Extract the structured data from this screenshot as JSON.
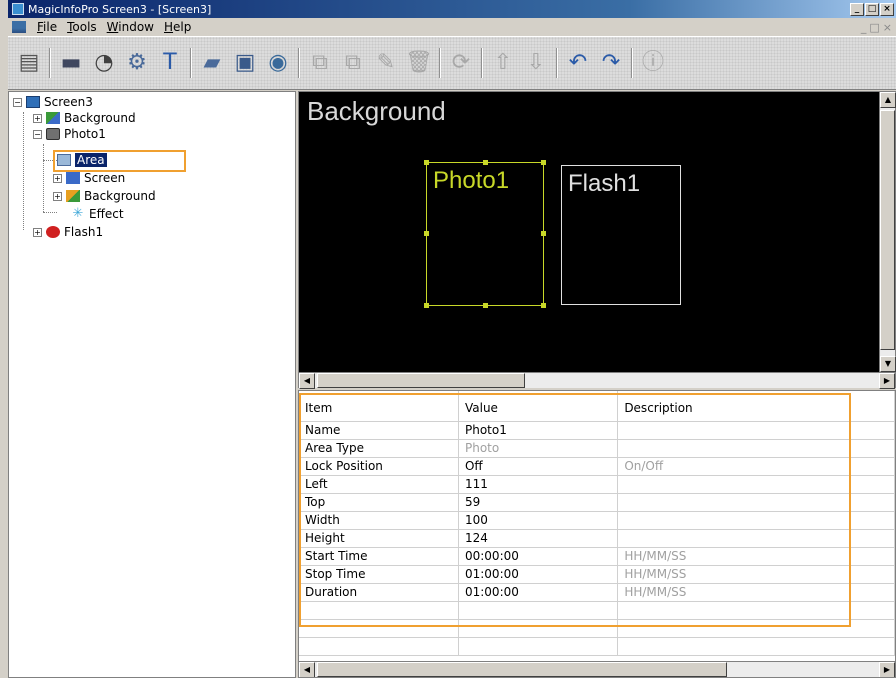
{
  "window": {
    "title": "MagicInfoPro Screen3 - [Screen3]",
    "buttons": [
      "_",
      "□",
      "×"
    ]
  },
  "menu": {
    "items": [
      "File",
      "Tools",
      "Window",
      "Help"
    ],
    "mdi_buttons": [
      "_",
      "□",
      "×"
    ]
  },
  "toolbar": {
    "buttons": [
      {
        "icon": "monitor-down-icon",
        "glyph": "▤",
        "color": "#555555"
      },
      {
        "icon": "display-icon",
        "glyph": "▬",
        "color": "#404860"
      },
      {
        "icon": "timer-icon",
        "glyph": "◔",
        "color": "#404040"
      },
      {
        "icon": "settings-icon",
        "glyph": "⚙",
        "color": "#4a6a9a"
      },
      {
        "icon": "text-icon",
        "glyph": "T",
        "color": "#2a5aa8"
      },
      {
        "icon": "open-folder-icon",
        "glyph": "▰",
        "color": "#4a6a9a"
      },
      {
        "icon": "save-icon",
        "glyph": "▣",
        "color": "#3a5a8a"
      },
      {
        "icon": "preview-icon",
        "glyph": "◉",
        "color": "#3a6a9a"
      },
      {
        "icon": "add-area-icon",
        "glyph": "⧉",
        "color": "#a8a8a8"
      },
      {
        "icon": "duplicate-area-icon",
        "glyph": "⧉",
        "color": "#a8a8a8"
      },
      {
        "icon": "paste-area-icon",
        "glyph": "✎",
        "color": "#a8a8a8"
      },
      {
        "icon": "delete-icon",
        "glyph": "🗑",
        "color": "#a8a8a8"
      },
      {
        "icon": "refresh-icon",
        "glyph": "⟳",
        "color": "#a8a8a8"
      },
      {
        "icon": "bring-front-icon",
        "glyph": "⇧",
        "color": "#a8a8a8"
      },
      {
        "icon": "send-back-icon",
        "glyph": "⇩",
        "color": "#a8a8a8"
      },
      {
        "icon": "undo-icon",
        "glyph": "↶",
        "color": "#2a5aa8"
      },
      {
        "icon": "redo-icon",
        "glyph": "↷",
        "color": "#2a5aa8"
      },
      {
        "icon": "info-icon",
        "glyph": "ⓘ",
        "color": "#a8a8a8"
      }
    ]
  },
  "tree": {
    "nodes": [
      {
        "label": "Screen3",
        "icon": "screen-icon",
        "expander": "−"
      },
      {
        "label": "Background",
        "icon": "background-icon",
        "expander": "+"
      },
      {
        "label": "Photo1",
        "icon": "photo-icon",
        "expander": "−"
      },
      {
        "label": "Area",
        "icon": "area-icon",
        "expander": "",
        "selected": true
      },
      {
        "label": "Screen",
        "icon": "screen-icon",
        "expander": "+"
      },
      {
        "label": "Background",
        "icon": "background-icon",
        "expander": "+"
      },
      {
        "label": "Effect",
        "icon": "effect-icon",
        "expander": ""
      },
      {
        "label": "Flash1",
        "icon": "flash-icon",
        "expander": "+"
      }
    ]
  },
  "canvas": {
    "title": "Background",
    "areas": [
      {
        "label": "Photo1",
        "selected": true
      },
      {
        "label": "Flash1",
        "selected": false
      }
    ]
  },
  "properties": {
    "headers": [
      "Item",
      "Value",
      "Description"
    ],
    "rows": [
      {
        "item": "Name",
        "value": "Photo1",
        "description": "",
        "value_dim": false
      },
      {
        "item": "Area Type",
        "value": "Photo",
        "description": "",
        "value_dim": true
      },
      {
        "item": "Lock Position",
        "value": "Off",
        "description": "On/Off",
        "value_dim": false
      },
      {
        "item": "Left",
        "value": "111",
        "description": "",
        "value_dim": false
      },
      {
        "item": "Top",
        "value": "59",
        "description": "",
        "value_dim": false
      },
      {
        "item": "Width",
        "value": "100",
        "description": "",
        "value_dim": false
      },
      {
        "item": "Height",
        "value": "124",
        "description": "",
        "value_dim": false
      },
      {
        "item": "Start Time",
        "value": "00:00:00",
        "description": "HH/MM/SS",
        "value_dim": false
      },
      {
        "item": "Stop Time",
        "value": "01:00:00",
        "description": "HH/MM/SS",
        "value_dim": false
      },
      {
        "item": "Duration",
        "value": "01:00:00",
        "description": "HH/MM/SS",
        "value_dim": false
      }
    ]
  },
  "colors": {
    "highlight": "#f0a030",
    "selected_area": "#c8d828",
    "selection_bg": "#0a246a"
  }
}
